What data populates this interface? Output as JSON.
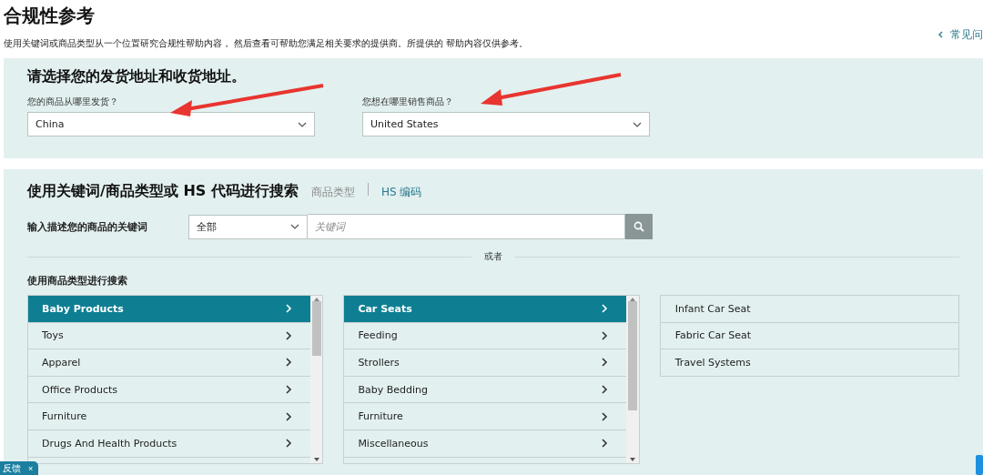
{
  "header": {
    "title": "合规性参考",
    "description": "使用关键词或商品类型从一个位置研究合规性帮助内容， 然后查看可帮助您满足相关要求的提供商。所提供的 帮助内容仅供参考。",
    "help_link": "常见问"
  },
  "address": {
    "title": "请选择您的发货地址和收货地址。",
    "from": {
      "label": "您的商品从哪里发货？",
      "value": "China"
    },
    "to": {
      "label": "您想在哪里销售商品？",
      "value": "United States"
    }
  },
  "search": {
    "title": "使用关键词/商品类型或 HS 代码进行搜索",
    "tabs": [
      {
        "label": "商品类型",
        "selected": false
      },
      {
        "label": "HS 编码",
        "selected": true
      }
    ],
    "keyword_label": "输入描述您的商品的关键词",
    "category_select": "全部",
    "placeholder": "关键词",
    "or": "或者",
    "category_title": "使用商品类型进行搜索"
  },
  "categories": [
    {
      "label": "Baby Products",
      "selected": true
    },
    {
      "label": "Toys",
      "selected": false
    },
    {
      "label": "Apparel",
      "selected": false
    },
    {
      "label": "Office Products",
      "selected": false
    },
    {
      "label": "Furniture",
      "selected": false
    },
    {
      "label": "Drugs And Health Products",
      "selected": false
    }
  ],
  "subcategories": [
    {
      "label": "Car Seats",
      "selected": true
    },
    {
      "label": "Feeding",
      "selected": false
    },
    {
      "label": "Strollers",
      "selected": false
    },
    {
      "label": "Baby Bedding",
      "selected": false
    },
    {
      "label": "Furniture",
      "selected": false
    },
    {
      "label": "Miscellaneous",
      "selected": false
    }
  ],
  "product_types": [
    {
      "label": "Infant Car Seat"
    },
    {
      "label": "Fabric Car Seat"
    },
    {
      "label": "Travel Systems"
    }
  ],
  "feedback": {
    "label": "反馈",
    "close": "×"
  }
}
